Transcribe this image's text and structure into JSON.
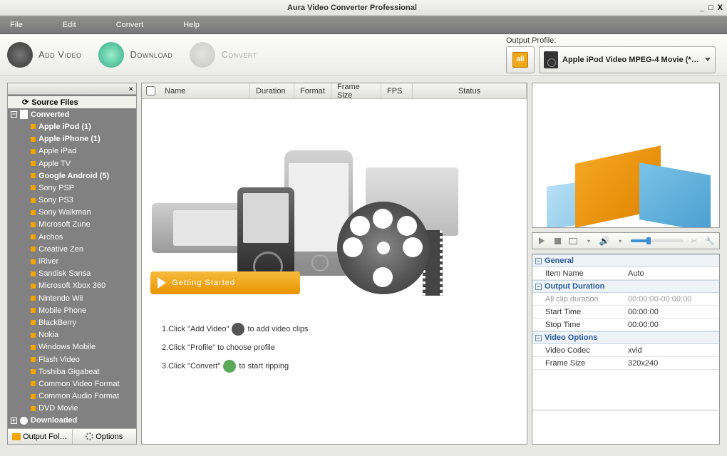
{
  "window": {
    "title": "Aura Video Converter Professional"
  },
  "menu": {
    "file": "File",
    "edit": "Edit",
    "convert": "Convert",
    "help": "Help"
  },
  "toolbar": {
    "add_video": "Add Video",
    "download": "Download",
    "convert": "Convert",
    "output_profile_label": "Output Profile:",
    "profile_all": "all",
    "profile_selected": "Apple iPod Video MPEG-4 Movie (*.m…"
  },
  "tree": {
    "source_files": "Source Files",
    "converted": "Converted",
    "downloaded": "Downloaded",
    "items": [
      {
        "label": "Apple iPod (1)",
        "bold": true
      },
      {
        "label": "Apple iPhone (1)",
        "bold": true
      },
      {
        "label": "Apple iPad",
        "bold": false
      },
      {
        "label": "Apple TV",
        "bold": false
      },
      {
        "label": "Google Android (5)",
        "bold": true
      },
      {
        "label": "Sony PSP",
        "bold": false
      },
      {
        "label": "Sony PS3",
        "bold": false
      },
      {
        "label": "Sony Walkman",
        "bold": false
      },
      {
        "label": "Microsoft Zune",
        "bold": false
      },
      {
        "label": "Archos",
        "bold": false
      },
      {
        "label": "Creative Zen",
        "bold": false
      },
      {
        "label": "iRiver",
        "bold": false
      },
      {
        "label": "Sandisk Sansa",
        "bold": false
      },
      {
        "label": "Microsoft Xbox 360",
        "bold": false
      },
      {
        "label": "Nintendo Wii",
        "bold": false
      },
      {
        "label": "Mobile Phone",
        "bold": false
      },
      {
        "label": "BlackBerry",
        "bold": false
      },
      {
        "label": "Nokia",
        "bold": false
      },
      {
        "label": "Windows Mobile",
        "bold": false
      },
      {
        "label": "Flash Video",
        "bold": false
      },
      {
        "label": "Toshiba Gigabeat",
        "bold": false
      },
      {
        "label": "Common Video Format",
        "bold": false
      },
      {
        "label": "Common Audio Format",
        "bold": false
      },
      {
        "label": "DVD Movie",
        "bold": false
      }
    ],
    "tabs": {
      "output_folder": "Output Fol…",
      "options": "Options"
    }
  },
  "columns": {
    "name": "Name",
    "duration": "Duration",
    "format": "Format",
    "frame_size": "Frame Size",
    "fps": "FPS",
    "status": "Status"
  },
  "getting_started": "Getting Started",
  "steps": {
    "s1a": "1.Click \"Add Video\"",
    "s1b": " to add video clips",
    "s2": "2.Click \"Profile\" to choose profile",
    "s3a": "3.Click \"Convert\"",
    "s3b": " to start ripping"
  },
  "props": {
    "general": "General",
    "item_name_k": "Item Name",
    "item_name_v": "Auto",
    "output_duration": "Output Duration",
    "all_clip_k": "All clip duration",
    "all_clip_v": "00:00:00-00:00:00",
    "start_k": "Start Time",
    "start_v": "00:00:00",
    "stop_k": "Stop Time",
    "stop_v": "00:00:00",
    "video_options": "Video Options",
    "codec_k": "Video Codec",
    "codec_v": "xvid",
    "frame_k": "Frame Size",
    "frame_v": "320x240"
  }
}
